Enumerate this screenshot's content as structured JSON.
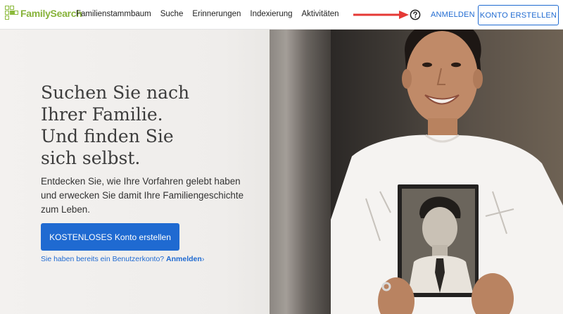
{
  "header": {
    "logo_text": "FamilySearch",
    "nav": [
      "Familienstammbaum",
      "Suche",
      "Erinnerungen",
      "Indexierung",
      "Aktivitäten"
    ],
    "sign_in": "ANMELDEN",
    "create_account": "KONTO ERSTELLEN"
  },
  "hero": {
    "headline_lines": [
      "Suchen Sie nach",
      "Ihrer Familie.",
      "Und finden Sie",
      "sich selbst."
    ],
    "subtext": "Entdecken Sie, wie Ihre Vorfahren gelebt haben und erwecken Sie damit Ihre Familiengeschichte zum Leben.",
    "cta": "KOSTENLOSES Konto erstellen",
    "existing_prefix": "Sie haben bereits ein Benutzerkonto? ",
    "existing_link": "Anmelden",
    "existing_chevron": "›"
  },
  "colors": {
    "brand_green": "#87b33a",
    "link_blue": "#1f6ad1",
    "annotation_arrow": "#e53935"
  },
  "icons": {
    "help": "question-circle-icon",
    "logo": "tree-logo-icon",
    "annotation": "red-arrow-icon"
  }
}
